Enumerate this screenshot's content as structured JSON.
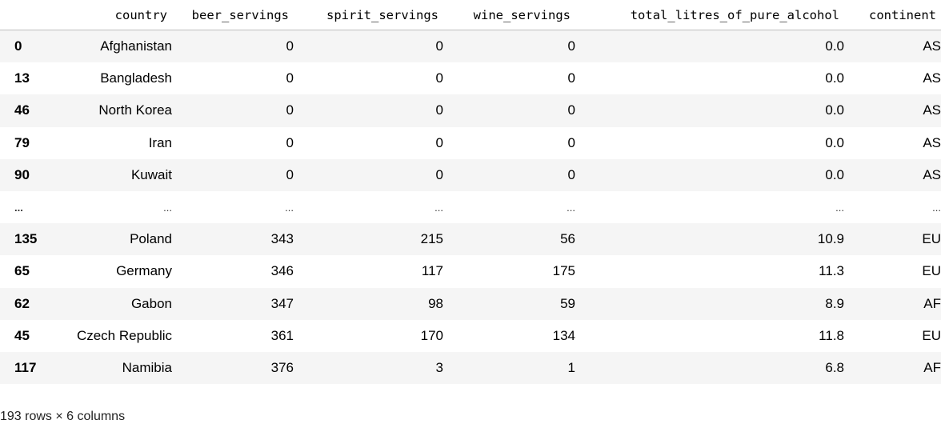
{
  "dataframe": {
    "columns": [
      "",
      "country",
      "beer_servings",
      "spirit_servings",
      "wine_servings",
      "total_litres_of_pure_alcohol",
      "continent"
    ],
    "rows": [
      {
        "index": "0",
        "country": "Afghanistan",
        "beer": "0",
        "spirit": "0",
        "wine": "0",
        "alcohol": "0.0",
        "continent": "AS"
      },
      {
        "index": "13",
        "country": "Bangladesh",
        "beer": "0",
        "spirit": "0",
        "wine": "0",
        "alcohol": "0.0",
        "continent": "AS"
      },
      {
        "index": "46",
        "country": "North Korea",
        "beer": "0",
        "spirit": "0",
        "wine": "0",
        "alcohol": "0.0",
        "continent": "AS"
      },
      {
        "index": "79",
        "country": "Iran",
        "beer": "0",
        "spirit": "0",
        "wine": "0",
        "alcohol": "0.0",
        "continent": "AS"
      },
      {
        "index": "90",
        "country": "Kuwait",
        "beer": "0",
        "spirit": "0",
        "wine": "0",
        "alcohol": "0.0",
        "continent": "AS"
      },
      {
        "index": "...",
        "country": "...",
        "beer": "...",
        "spirit": "...",
        "wine": "...",
        "alcohol": "...",
        "continent": "..."
      },
      {
        "index": "135",
        "country": "Poland",
        "beer": "343",
        "spirit": "215",
        "wine": "56",
        "alcohol": "10.9",
        "continent": "EU"
      },
      {
        "index": "65",
        "country": "Germany",
        "beer": "346",
        "spirit": "117",
        "wine": "175",
        "alcohol": "11.3",
        "continent": "EU"
      },
      {
        "index": "62",
        "country": "Gabon",
        "beer": "347",
        "spirit": "98",
        "wine": "59",
        "alcohol": "8.9",
        "continent": "AF"
      },
      {
        "index": "45",
        "country": "Czech Republic",
        "beer": "361",
        "spirit": "170",
        "wine": "134",
        "alcohol": "11.8",
        "continent": "EU"
      },
      {
        "index": "117",
        "country": "Namibia",
        "beer": "376",
        "spirit": "3",
        "wine": "1",
        "alcohol": "6.8",
        "continent": "AF"
      }
    ],
    "shape_text": "193 rows × 6 columns"
  },
  "colors": {
    "row_odd": "#f5f5f5",
    "row_even": "#ffffff",
    "header_border": "#bdbdbd"
  }
}
